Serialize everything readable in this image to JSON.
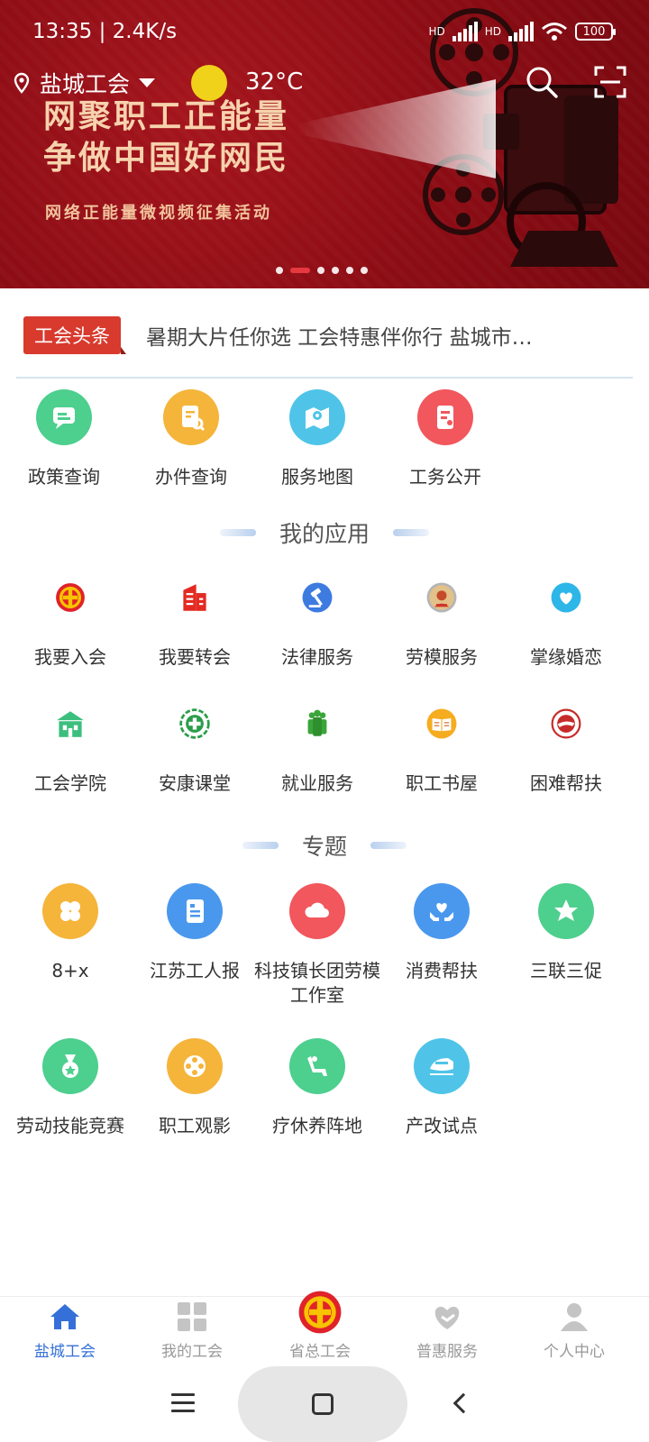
{
  "status": {
    "time": "13:35",
    "speed": "2.4K/s",
    "hd1": "HD",
    "hd2": "HD",
    "battery": "100"
  },
  "header": {
    "location": "盐城工会",
    "temperature": "32°C",
    "search_icon": "search-icon",
    "scan_icon": "scan-icon"
  },
  "banner": {
    "line1": "网聚职工正能量",
    "line2": "争做中国好网民",
    "line3": "网络正能量微视频征集活动",
    "slide_count": 6,
    "active_slide": 2
  },
  "headline": {
    "tag": "工会头条",
    "text": "暑期大片任你选 工会特惠伴你行 盐城市…"
  },
  "quick": [
    {
      "label": "政策查询",
      "icon": "chat-icon",
      "color": "#4dcf8e"
    },
    {
      "label": "办件查询",
      "icon": "document-search-icon",
      "color": "#f5b43a"
    },
    {
      "label": "服务地图",
      "icon": "map-icon",
      "color": "#4fc4e8"
    },
    {
      "label": "工务公开",
      "icon": "notice-icon",
      "color": "#f1575d"
    }
  ],
  "apps_title": "我的应用",
  "apps": [
    {
      "label": "我要入会",
      "icon": "union-emblem-icon"
    },
    {
      "label": "我要转会",
      "icon": "building-icon"
    },
    {
      "label": "法律服务",
      "icon": "gavel-icon"
    },
    {
      "label": "劳模服务",
      "icon": "medal-portrait-icon"
    },
    {
      "label": "掌缘婚恋",
      "icon": "heart-icon"
    },
    {
      "label": "工会学院",
      "icon": "school-icon"
    },
    {
      "label": "安康课堂",
      "icon": "health-cross-icon"
    },
    {
      "label": "就业服务",
      "icon": "people-icon"
    },
    {
      "label": "职工书屋",
      "icon": "book-icon"
    },
    {
      "label": "困难帮扶",
      "icon": "help-badge-icon"
    }
  ],
  "topics_title": "专题",
  "topics": [
    {
      "label": "8+x",
      "icon": "clover-icon",
      "color": "#f5b43a"
    },
    {
      "label": "江苏工人报",
      "icon": "newspaper-icon",
      "color": "#4a98ee"
    },
    {
      "label": "科技镇长团劳模工作室",
      "icon": "cloud-icon",
      "color": "#f1575d"
    },
    {
      "label": "消费帮扶",
      "icon": "hands-heart-icon",
      "color": "#4a98ee"
    },
    {
      "label": "三联三促",
      "icon": "star-icon",
      "color": "#4dcf8e"
    },
    {
      "label": "劳动技能竞赛",
      "icon": "medal-icon",
      "color": "#4dcf8e"
    },
    {
      "label": "职工观影",
      "icon": "film-reel-icon",
      "color": "#f5b43a"
    },
    {
      "label": "疗休养阵地",
      "icon": "lounge-chair-icon",
      "color": "#4dcf8e"
    },
    {
      "label": "产改试点",
      "icon": "train-icon",
      "color": "#4fc4e8"
    }
  ],
  "nav": [
    {
      "label": "盐城工会",
      "icon": "home-icon",
      "active": true
    },
    {
      "label": "我的工会",
      "icon": "grid-icon",
      "active": false
    },
    {
      "label": "省总工会",
      "icon": "union-emblem-icon",
      "active": false
    },
    {
      "label": "普惠服务",
      "icon": "heart-hand-icon",
      "active": false
    },
    {
      "label": "个人中心",
      "icon": "person-icon",
      "active": false
    }
  ],
  "colors": {
    "brand_red": "#a5151d",
    "accent_blue": "#3570d8",
    "tag_red": "#d83a2e"
  }
}
